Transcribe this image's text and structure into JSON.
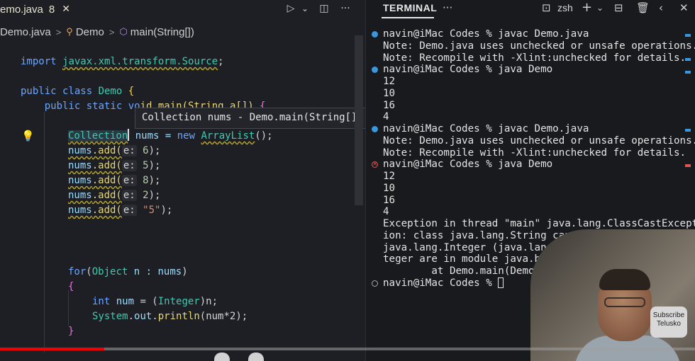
{
  "editor": {
    "tab": {
      "filename": "emo.java",
      "problems": "8",
      "close": "✕"
    },
    "toolbar": {
      "run": "▷",
      "run_menu": "⌄",
      "split": "◫",
      "more": "···"
    },
    "breadcrumb": {
      "file": "Demo.java",
      "sep1": ">",
      "class_icon": "⚲",
      "class": "Demo",
      "sep2": ">",
      "method_icon": "⬡",
      "method": "main(String[])"
    },
    "tooltip": "Collection nums - Demo.main(String[])",
    "code": {
      "l1": [
        "import ",
        "javax.xml.transform.Source",
        ";"
      ],
      "l3": [
        "public class ",
        "Demo",
        " {"
      ],
      "l4": [
        "    public static vo",
        "id main(String a[]) ",
        "{"
      ],
      "l6_type": "Collection",
      "l6_rest": [
        " nums = ",
        "new ",
        "ArrayList",
        "();"
      ],
      "adds": [
        {
          "obj": "nums",
          "call": ".add(",
          "hint": "e:",
          "arg": " 6",
          "end": ");"
        },
        {
          "obj": "nums",
          "call": ".add(",
          "hint": "e:",
          "arg": " 5",
          "end": ");"
        },
        {
          "obj": "nums",
          "call": ".add(",
          "hint": "e:",
          "arg": " 8",
          "end": ");"
        },
        {
          "obj": "nums",
          "call": ".add(",
          "hint": "e:",
          "arg": " 2",
          "end": ");"
        },
        {
          "obj": "nums",
          "call": ".add(",
          "hint": "e:",
          "arg": " \"5\"",
          "end": ");"
        }
      ],
      "for": [
        "for",
        "(",
        "Object",
        " n : ",
        "nums",
        ")"
      ],
      "open_brace": "{",
      "int_line": [
        "int ",
        "num",
        " = (",
        "Integer",
        ")n;"
      ],
      "print_line": [
        "System",
        ".",
        "out",
        ".",
        "println",
        "(num*2);"
      ],
      "close_brace": "}"
    }
  },
  "terminal": {
    "tab": "TERMINAL",
    "more": "···",
    "shell": "zsh",
    "lines": [
      {
        "dot": "ok",
        "text": "navin@iMac Codes % javac Demo.java"
      },
      {
        "dot": "",
        "text": "Note: Demo.java uses unchecked or unsafe operations."
      },
      {
        "dot": "",
        "text": "Note: Recompile with -Xlint:unchecked for details."
      },
      {
        "dot": "ok",
        "text": "navin@iMac Codes % java Demo"
      },
      {
        "dot": "",
        "text": "12"
      },
      {
        "dot": "",
        "text": "10"
      },
      {
        "dot": "",
        "text": "16"
      },
      {
        "dot": "",
        "text": "4"
      },
      {
        "dot": "ok",
        "text": "navin@iMac Codes % javac Demo.java"
      },
      {
        "dot": "",
        "text": "Note: Demo.java uses unchecked or unsafe operations."
      },
      {
        "dot": "",
        "text": "Note: Recompile with -Xlint:unchecked for details."
      },
      {
        "dot": "err",
        "text": "navin@iMac Codes % java Demo"
      },
      {
        "dot": "",
        "text": "12"
      },
      {
        "dot": "",
        "text": "10"
      },
      {
        "dot": "",
        "text": "16"
      },
      {
        "dot": "",
        "text": "4"
      },
      {
        "dot": "",
        "text": "Exception in thread \"main\" java.lang.ClassCastExcept"
      },
      {
        "dot": "",
        "text": "ion: class java.lang.String cannot"
      },
      {
        "dot": "",
        "text": "java.lang.Integer (java.lang.St"
      },
      {
        "dot": "",
        "text": "teger are in module java.base"
      },
      {
        "dot": "",
        "text": "        at Demo.main(Demo.j"
      },
      {
        "dot": "idle",
        "text": "navin@iMac Codes % "
      }
    ]
  },
  "overlay": {
    "subscribe_line1": "Subscribe",
    "subscribe_line2": "Telusko",
    "progress": 0.15
  },
  "colors": {
    "accent": "#3a96dd",
    "error": "#e05555",
    "progress": "#f00000"
  }
}
